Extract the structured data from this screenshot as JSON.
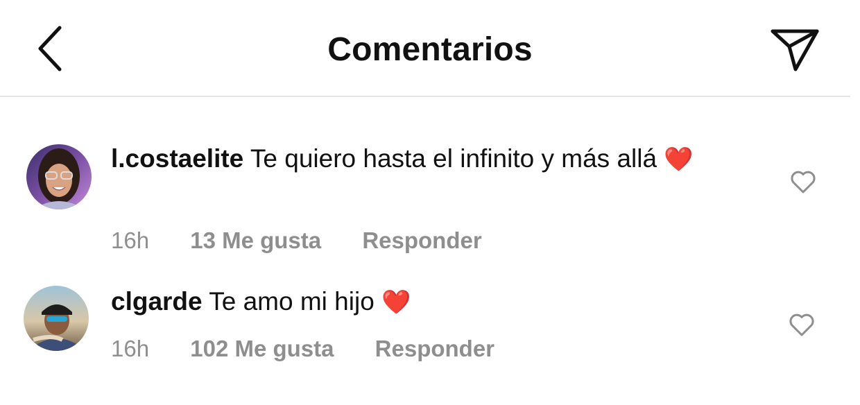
{
  "header": {
    "title": "Comentarios"
  },
  "comments": [
    {
      "username": "l.costaelite",
      "text": "Te quiero hasta el infinito y más allá",
      "emoji": "❤️",
      "time": "16h",
      "likes": "13 Me gusta",
      "reply": "Responder"
    },
    {
      "username": "clgarde",
      "text": "Te amo mi hijo",
      "emoji": "❤️",
      "time": "16h",
      "likes": "102 Me gusta",
      "reply": "Responder"
    }
  ],
  "icons": {
    "back": "chevron-left-icon",
    "share": "paper-plane-icon",
    "like": "heart-outline-icon"
  },
  "colors": {
    "text": "#111111",
    "meta": "#8e8e8e",
    "divider": "#e3e3e3",
    "heart_emoji": "#e8202c"
  }
}
